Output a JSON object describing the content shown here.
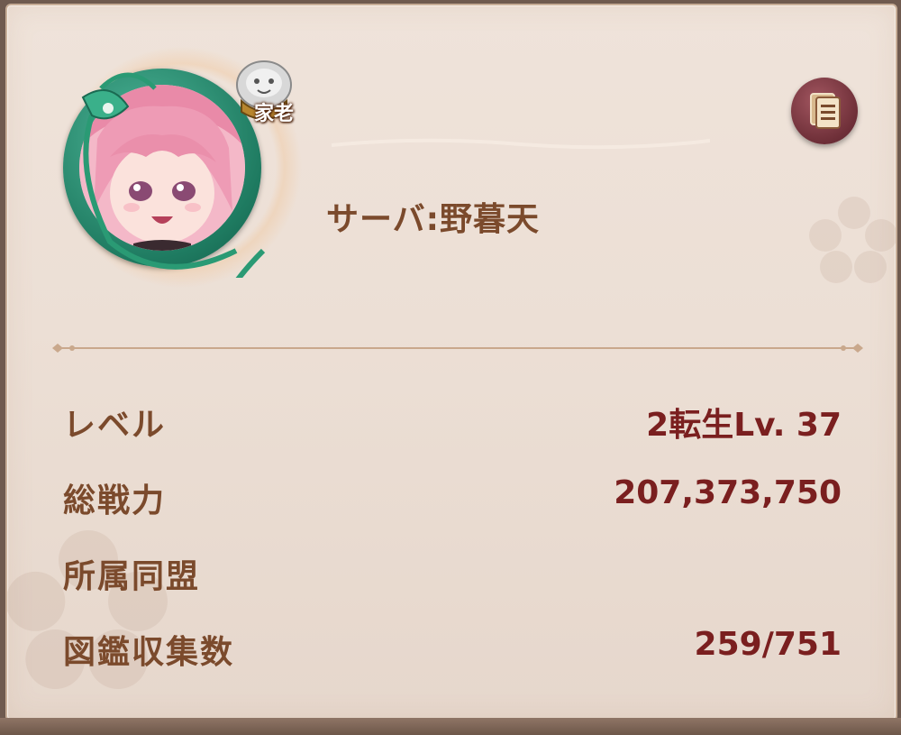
{
  "profile": {
    "rank_badge": "家老",
    "server_label": "サーバ:野暮天",
    "portrait_icon": "character-portrait",
    "doc_icon": "document-list-icon"
  },
  "stats": [
    {
      "label": "レベル",
      "value": "2転生Lv. 37"
    },
    {
      "label": "総戦力",
      "value": "207,373,750"
    },
    {
      "label": "所属同盟",
      "value": ""
    },
    {
      "label": "図鑑収集数",
      "value": "259/751"
    }
  ],
  "colors": {
    "panel_bg": "#ecdfd5",
    "label_brown": "#7b4a2c",
    "value_red": "#7a1f1f",
    "ring_green": "#1e7a60",
    "button_maroon": "#6e2f38"
  }
}
